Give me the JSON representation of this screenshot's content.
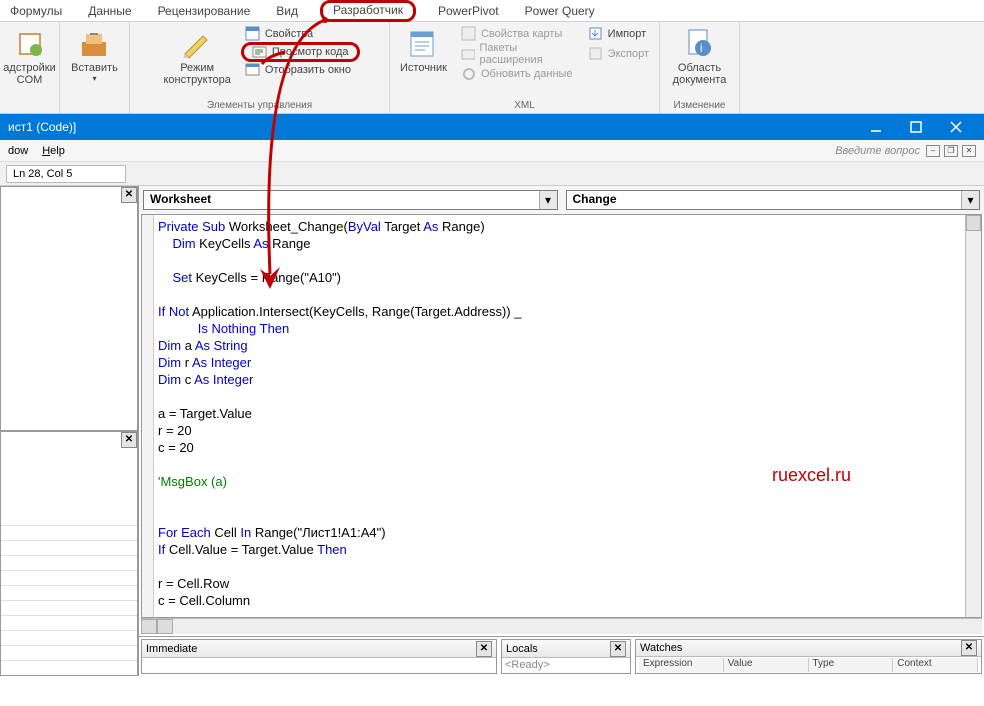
{
  "excel_tabs": {
    "t0": "Формулы",
    "t1": "Данные",
    "t2": "Рецензирование",
    "t3": "Вид",
    "t4": "Разработчик",
    "t5": "PowerPivot",
    "t6": "Power Query"
  },
  "ribbon": {
    "addins": {
      "label1": "адстройки",
      "label2": "COM"
    },
    "insert": "Вставить",
    "design_mode": {
      "l1": "Режим",
      "l2": "конструктора"
    },
    "properties": "Свойства",
    "view_code": "Просмотр кода",
    "show_window": "Отобразить окно",
    "group_controls": "Элементы управления",
    "source": "Источник",
    "map_props": "Свойства карты",
    "exp_packs": "Пакеты расширения",
    "refresh": "Обновить данные",
    "import": "Импорт",
    "export": "Экспорт",
    "group_xml": "XML",
    "doc_area": {
      "l1": "Область",
      "l2": "документа"
    },
    "group_change": "Изменение"
  },
  "vbe": {
    "title": "ист1 (Code)]",
    "menu_dow": "dow",
    "menu_help": "Help",
    "help_search": "Введите вопрос",
    "status": "Ln 28, Col 5",
    "dd_object": "Worksheet",
    "dd_proc": "Change",
    "watermark": "ruexcel.ru",
    "bottom": {
      "immediate": "Immediate",
      "locals": "Locals",
      "locals_body": "<Ready>",
      "watches": "Watches",
      "w_cols": {
        "c1": "Expression",
        "c2": "Value",
        "c3": "Type",
        "c4": "Context"
      }
    }
  },
  "code": {
    "l01a": "Private ",
    "l01b": "Sub ",
    "l01c": "Worksheet_Change(",
    "l01d": "ByVal ",
    "l01e": "Target ",
    "l01f": "As ",
    "l01g": "Range)",
    "l02a": "    Dim ",
    "l02b": "KeyCells ",
    "l02c": "As ",
    "l02d": "Range",
    "l03": "",
    "l04a": "    Set ",
    "l04b": "KeyCells = Range(\"A10\")",
    "l05": "",
    "l06a": "If Not ",
    "l06b": "Application.Intersect(KeyCells, Range(Target.Address)) _",
    "l07a": "           Is Nothing Then",
    "l08a": "Dim ",
    "l08b": "a ",
    "l08c": "As String",
    "l09a": "Dim ",
    "l09b": "r ",
    "l09c": "As Integer",
    "l10a": "Dim ",
    "l10b": "c ",
    "l10c": "As Integer",
    "l11": "",
    "l12": "a = Target.Value",
    "l13": "r = 20",
    "l14": "c = 20",
    "l15": "",
    "l16": "'MsgBox (a)",
    "l17": "",
    "l18": "",
    "l19a": "For Each ",
    "l19b": "Cell ",
    "l19c": "In ",
    "l19d": "Range(\"Лист1!A1:A4\")",
    "l20a": "If ",
    "l20b": "Cell.Value = Target.Value ",
    "l20c": "Then",
    "l21": "",
    "l22": "r = Cell.Row",
    "l23": "c = Cell.Column"
  }
}
